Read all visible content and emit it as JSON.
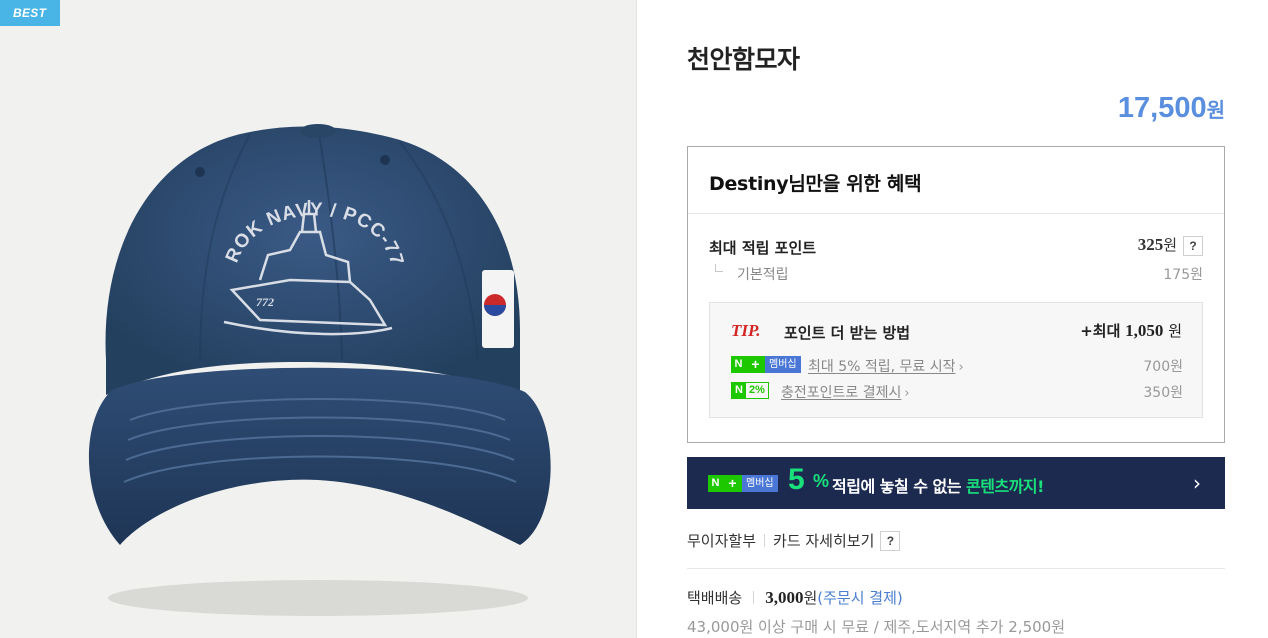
{
  "badge": "BEST",
  "product": {
    "image_alt": "navy baseball cap",
    "cap_embroidery": "ROK NAVY / PCC-772",
    "ship_number": "772",
    "title": "천안함모자",
    "price_num": "17,500",
    "price_unit": "원"
  },
  "benefit": {
    "title": "Destiny님만을 위한 혜택",
    "max_points_label": "최대 적립 포인트",
    "max_points_value": "325",
    "won": "원",
    "help": "?",
    "base_label": "기본적립",
    "base_value": "175원",
    "tip": {
      "tip_word": "TIP.",
      "text": "포인트 더 받는 방법",
      "max_prefix": "+최대",
      "max_value": "1,050",
      "max_unit": "원",
      "rows": [
        {
          "badge_n": "N",
          "badge_plus": "+",
          "badge_label": "멤버십",
          "link": "최대 5% 적립, 무료 시작",
          "amount": "700원"
        },
        {
          "badge_n": "N",
          "badge_pct": "2%",
          "link": "충전포인트로 결제시",
          "amount": "350원"
        }
      ],
      "arrow": "›"
    }
  },
  "banner": {
    "badge_n": "N",
    "badge_plus": "+",
    "badge_label": "멤버십",
    "big": "5",
    "pct": "%",
    "text_white": "적립에 놓칠 수 없는 ",
    "text_green": "콘텐츠까지!",
    "chevron": "›"
  },
  "install": {
    "label1": "무이자할부",
    "label2": "카드 자세히보기",
    "help": "?"
  },
  "shipping": {
    "method": "택배배송",
    "fee": "3,000",
    "unit": "원",
    "note": "(주문시 결제)",
    "free_info": "43,000원 이상 구매 시 무료 / 제주,도서지역 추가 2,500원"
  },
  "colors": {
    "price": "#5a8ede",
    "best_badge": "#49b4e6",
    "banner_bg": "#1c2a50",
    "accent_green": "#19e07b",
    "tip_red": "#d52424",
    "cap_navy": "#2c4a73"
  }
}
